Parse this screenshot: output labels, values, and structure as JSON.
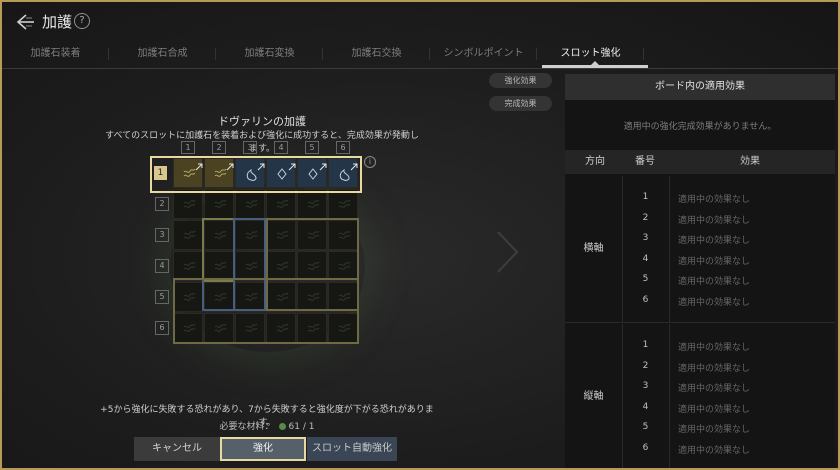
{
  "header": {
    "title": "加護",
    "help": "?"
  },
  "tabs": [
    "加護石装着",
    "加護石合成",
    "加護石変換",
    "加護石交換",
    "シンボルポイント",
    "スロット強化"
  ],
  "active_tab": "スロット強化",
  "board": {
    "title": "ドヴァリンの加護",
    "description": "すべてのスロットに加護石を装着および強化に成功すると、完成効果が発動します。",
    "columns": [
      "1",
      "2",
      "3",
      "4",
      "5",
      "6"
    ],
    "rows": [
      "1",
      "2",
      "3",
      "4",
      "5",
      "6"
    ],
    "info": "i"
  },
  "warning": "+5から強化に失敗する恐れがあり、7から失敗すると強化度が下がる恐れがあります。",
  "materials": {
    "label": "必要な材料：",
    "value": "61 / 1"
  },
  "buttons": {
    "cancel": "キャンセル",
    "enhance": "強化",
    "auto": "スロット自動強化"
  },
  "side_buttons": {
    "enhance_effect": "強化効果",
    "complete_effect": "完成効果"
  },
  "panel": {
    "title": "ボード内の適用効果",
    "none_text": "適用中の強化完成効果がありません。",
    "headers": {
      "direction": "方向",
      "number": "番号",
      "effect": "効果"
    },
    "groups": [
      {
        "label": "横軸",
        "rows": [
          {
            "num": "1",
            "effect": "適用中の効果なし"
          },
          {
            "num": "2",
            "effect": "適用中の効果なし"
          },
          {
            "num": "3",
            "effect": "適用中の効果なし"
          },
          {
            "num": "4",
            "effect": "適用中の効果なし"
          },
          {
            "num": "5",
            "effect": "適用中の効果なし"
          },
          {
            "num": "6",
            "effect": "適用中の効果なし"
          }
        ]
      },
      {
        "label": "縦軸",
        "rows": [
          {
            "num": "1",
            "effect": "適用中の効果なし"
          },
          {
            "num": "2",
            "effect": "適用中の効果なし"
          },
          {
            "num": "3",
            "effect": "適用中の効果なし"
          },
          {
            "num": "4",
            "effect": "適用中の効果なし"
          },
          {
            "num": "5",
            "effect": "適用中の効果なし"
          },
          {
            "num": "6",
            "effect": "適用中の効果なし"
          }
        ]
      }
    ]
  },
  "colors": {
    "frame": "#b79a56",
    "highlight": "#e9d9a0",
    "yellow_cell": "#4a4220",
    "blue_cell": "#233547"
  }
}
